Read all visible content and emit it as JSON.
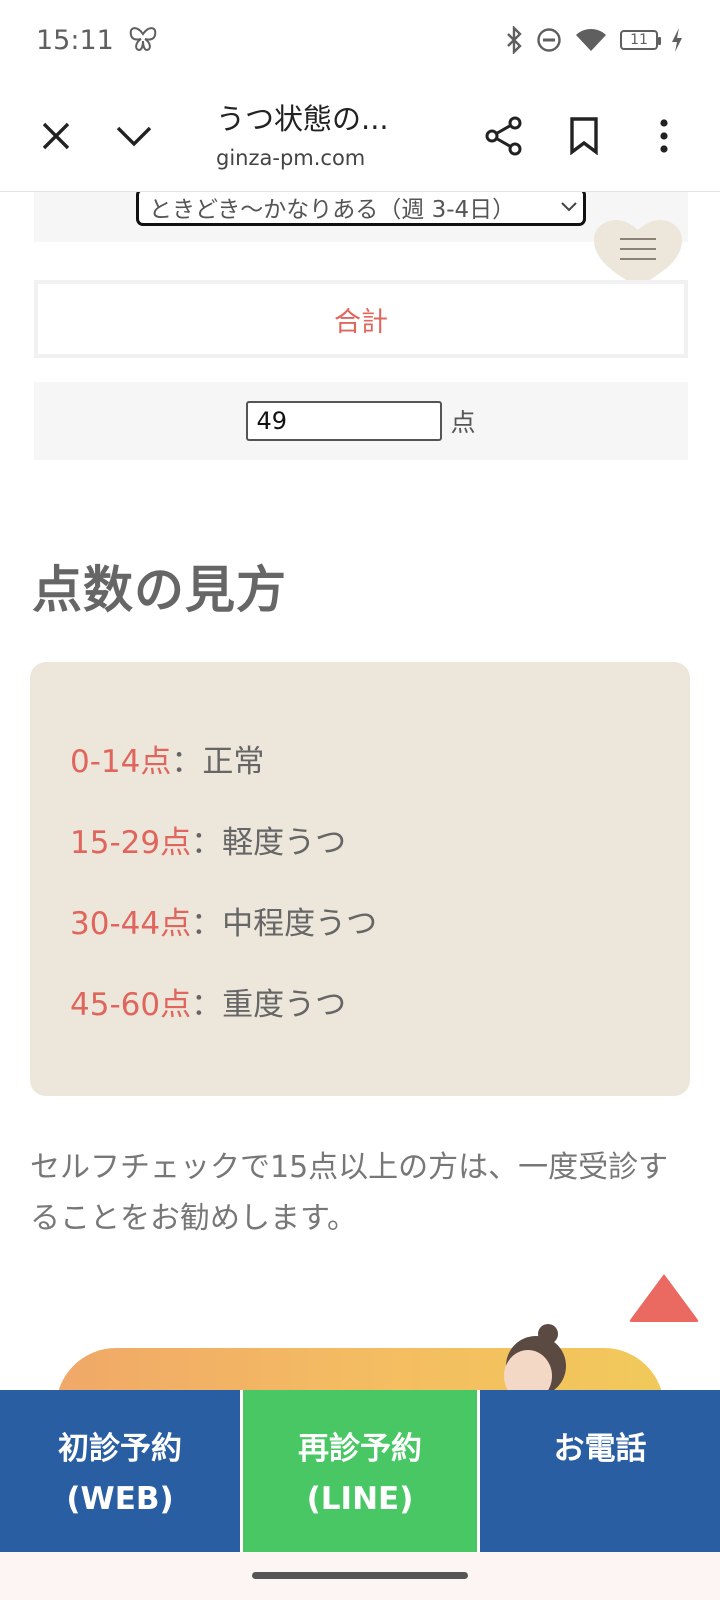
{
  "status_bar": {
    "time": "15:11",
    "notification_icon": "butterfly-icon",
    "battery_level": "11",
    "icons": [
      "bluetooth-icon",
      "do-not-disturb-icon",
      "wifi-icon",
      "battery-icon",
      "charging-icon"
    ]
  },
  "browser": {
    "page_title": "うつ状態の...",
    "url": "ginza-pm.com",
    "buttons": [
      "close-icon",
      "chevron-down-icon",
      "share-icon",
      "bookmark-icon",
      "more-vert-icon"
    ]
  },
  "form": {
    "select_value": "ときどき〜かなりある（週 3-4日）",
    "total_label": "合計",
    "score_value": "49",
    "score_unit": "点"
  },
  "scoring": {
    "title": "点数の見方",
    "items": [
      {
        "range": "0-14点",
        "sep": "：",
        "label": "正常"
      },
      {
        "range": "15-29点",
        "sep": "：",
        "label": "軽度うつ"
      },
      {
        "range": "30-44点",
        "sep": "：",
        "label": "中程度うつ"
      },
      {
        "range": "45-60点",
        "sep": "：",
        "label": "重度うつ"
      }
    ],
    "note": "セルフチェックで15点以上の方は、一度受診することをお勧めします。"
  },
  "bottom_nav": {
    "web": {
      "line1": "初診予約",
      "line2": "(WEB)"
    },
    "line": {
      "line1": "再診予約",
      "line2": "(LINE)"
    },
    "tel": {
      "line1": "お電話"
    }
  },
  "colors": {
    "accent_red": "#e0665d",
    "legend_bg": "#ede6db",
    "nav_blue": "#2a5ea3",
    "nav_green": "#4ac765"
  }
}
